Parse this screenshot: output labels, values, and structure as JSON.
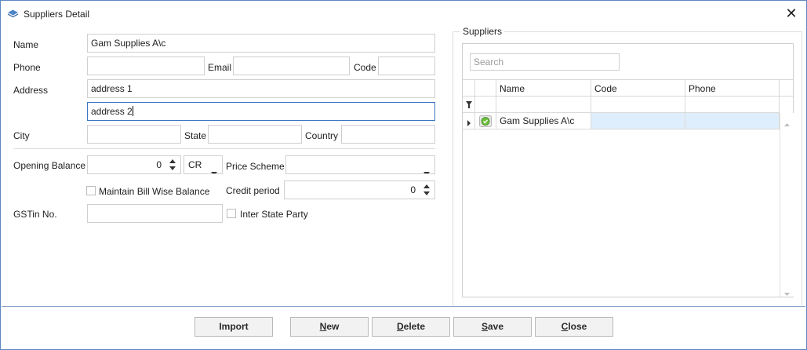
{
  "window": {
    "title": "Suppliers Detail",
    "close_glyph": "✕",
    "icon": "suppliers-app-icon"
  },
  "form": {
    "name_label": "Name",
    "name_value": "Gam Supplies A\\c",
    "phone_label": "Phone",
    "phone_value": "",
    "email_label": "Email",
    "email_value": "",
    "code_label": "Code",
    "code_value": "",
    "address_label": "Address",
    "address1_value": "address 1",
    "address2_value": "address 2",
    "city_label": "City",
    "city_value": "",
    "state_label": "State",
    "state_value": "",
    "country_label": "Country",
    "country_value": "",
    "opening_balance_label": "Opening Balance",
    "opening_balance_value": "0",
    "balance_type_value": "CR",
    "price_scheme_label": "Price Scheme",
    "price_scheme_value": "",
    "maintain_bill_label": "Maintain Bill Wise Balance",
    "credit_period_label": "Credit period",
    "credit_period_value": "0",
    "gstin_label": "GSTin No.",
    "gstin_value": "",
    "inter_state_label": "Inter State Party"
  },
  "suppliers": {
    "group_title": "Suppliers",
    "search_placeholder": "Search",
    "columns": [
      "Name",
      "Code",
      "Phone"
    ],
    "rows": [
      {
        "name": "Gam Supplies A\\c",
        "code": "",
        "phone": "",
        "status": "active-check-icon"
      }
    ]
  },
  "buttons": {
    "import": "Import",
    "new_first": "N",
    "new_rest": "ew",
    "delete_first": "D",
    "delete_rest": "elete",
    "save_first": "S",
    "save_rest": "ave",
    "close_first": "C",
    "close_rest": "lose"
  },
  "colors": {
    "accent": "#3b78c4",
    "selected_row": "#dfeefc",
    "status_green": "#6cbf3a"
  }
}
